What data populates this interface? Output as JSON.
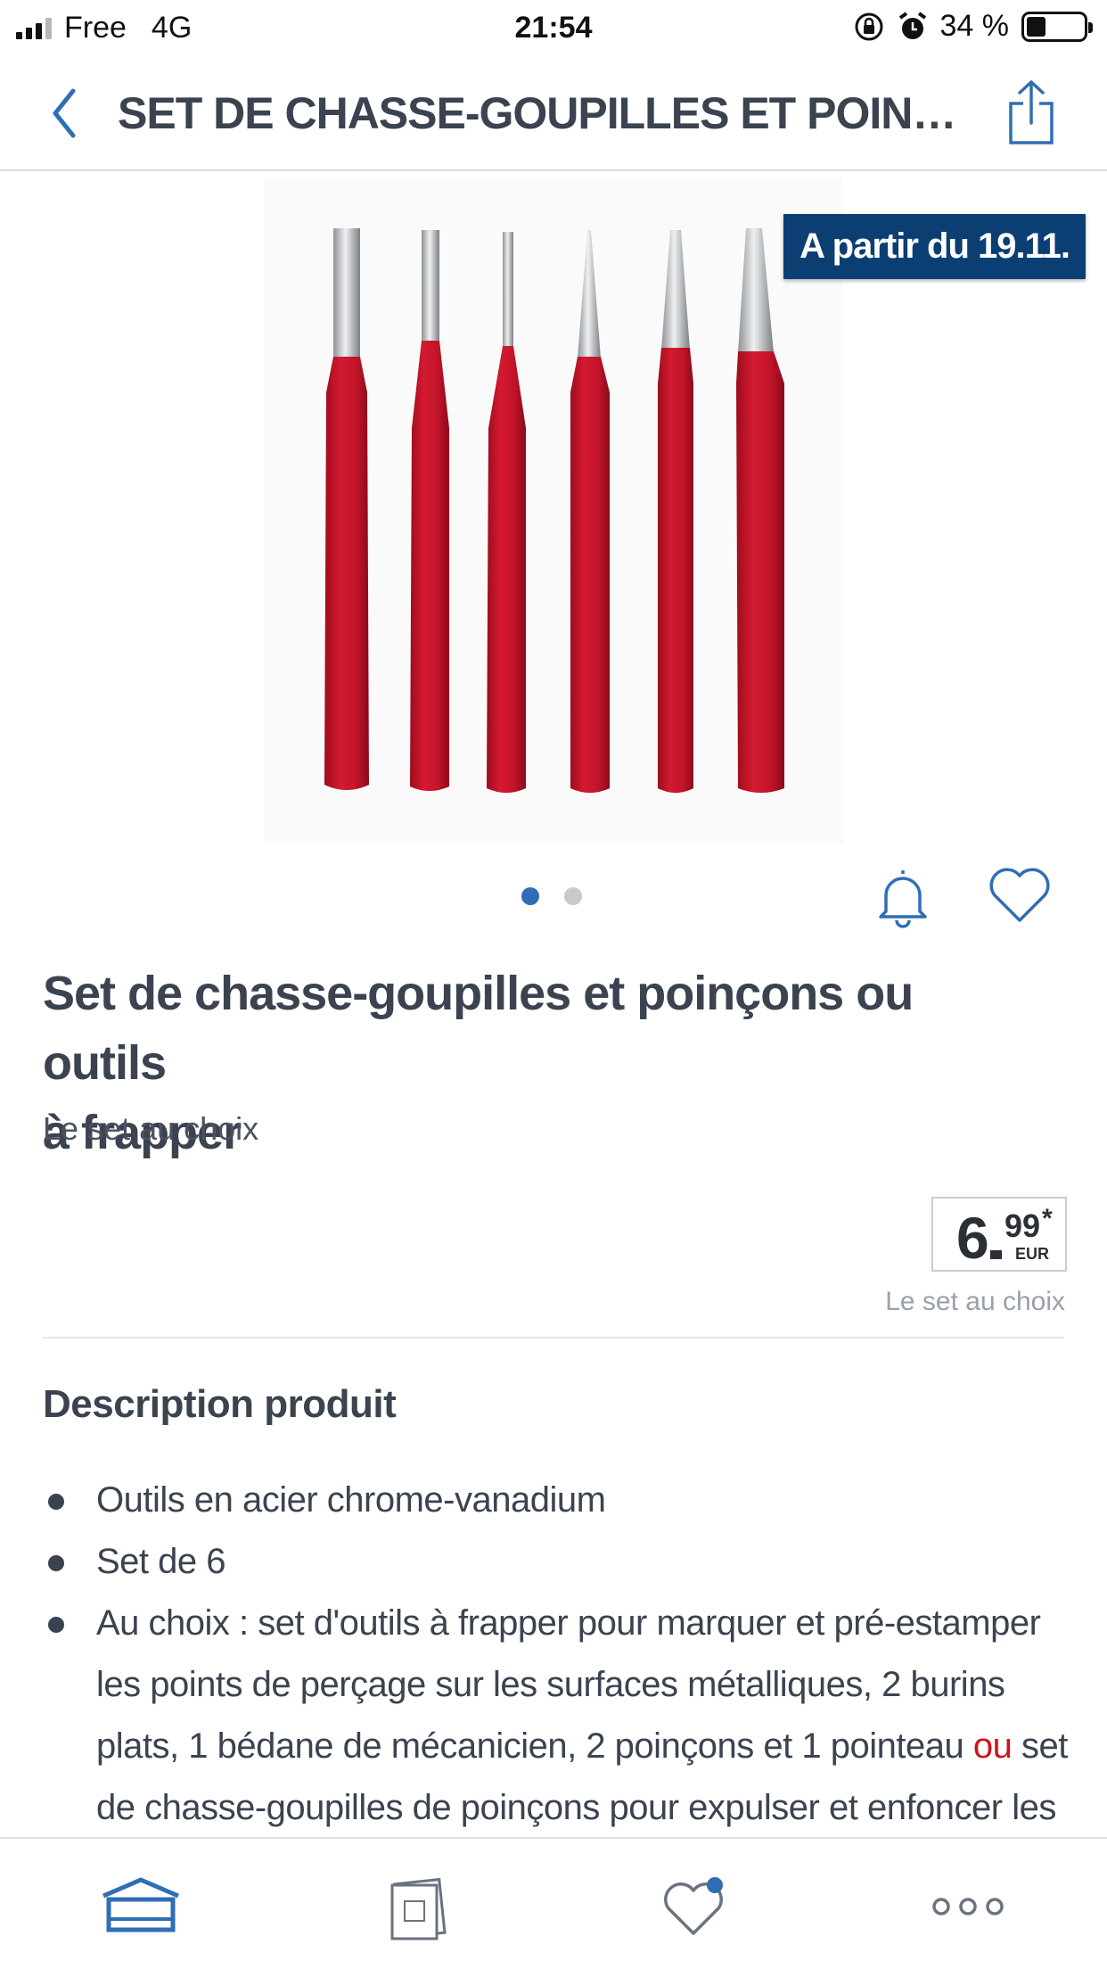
{
  "status_bar": {
    "carrier": "Free",
    "network": "4G",
    "time": "21:54",
    "battery": "34 %"
  },
  "nav": {
    "title": "SET DE CHASSE-GOUPILLES ET POINÇONS OU…"
  },
  "badge": "A partir du 19.11.",
  "gallery": {
    "pages": 2,
    "current": 1
  },
  "product": {
    "title_line1": "Set de chasse-goupilles et poinçons ou outils",
    "title_line2": "à frapper",
    "subtitle": "Le set au choix"
  },
  "price": {
    "main": "6",
    "cents": "99",
    "star": "*",
    "currency": "EUR",
    "note": "Le set au choix"
  },
  "description": {
    "title": "Description produit",
    "bullets": [
      "Outils en acier chrome-vanadium",
      "Set de 6"
    ],
    "bullet3_a": "Au choix : set d'outils à frapper pour marquer et pré-estamper les points de perçage sur les surfaces métalliques, 2 burins plats, 1 bédane de mécanicien, 2 poinçons et 1 pointeau ",
    "bullet3_or": "ou",
    "bullet3_b": " set de chasse-goupilles de poinçons pour expulser et enfoncer les rivets, goupilles,"
  },
  "colors": {
    "accent": "#2f6eb5",
    "badge": "#0b3f73",
    "tool_red": "#c8102e",
    "or_red": "#d0121a"
  },
  "icons": {
    "back": "chevron-left-icon",
    "share": "share-icon",
    "bell": "bell-icon",
    "heart": "heart-icon",
    "tab_home": "home-icon",
    "tab_leaflet": "leaflet-icon",
    "tab_favorites": "heart-icon",
    "tab_more": "more-icon"
  }
}
